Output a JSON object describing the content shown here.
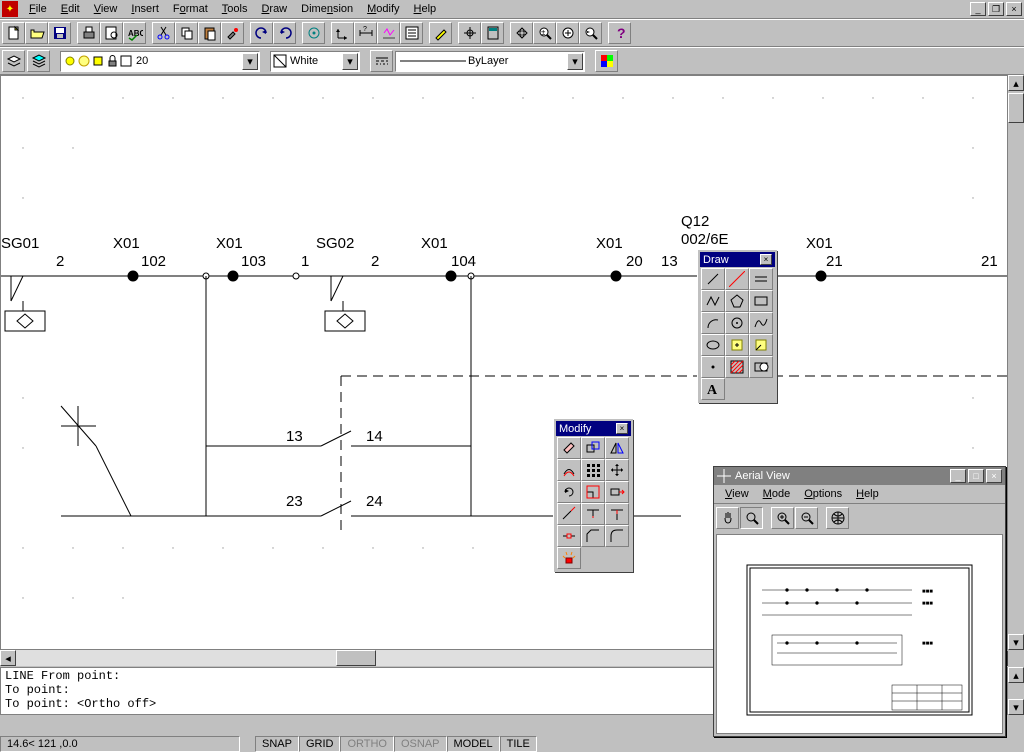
{
  "menu": {
    "file": "File",
    "edit": "Edit",
    "view": "View",
    "insert": "Insert",
    "format": "Format",
    "tools": "Tools",
    "draw": "Draw",
    "dimension": "Dimension",
    "modify": "Modify",
    "help": "Help"
  },
  "layer": {
    "current": "20",
    "color": "White",
    "linetype": "ByLayer"
  },
  "schematic": {
    "labels": {
      "sg01": "SG01",
      "sg02": "SG02",
      "q12": "Q12",
      "q12_val": "002/6E",
      "x01a": "X01",
      "x01b": "X01",
      "x01c": "X01",
      "x01d": "X01",
      "x01e": "X01",
      "n2a": "2",
      "n102": "102",
      "n103": "103",
      "n1": "1",
      "n2b": "2",
      "n104": "104",
      "n20": "20",
      "n13a": "13",
      "n21": "21",
      "n21b": "21",
      "n13": "13",
      "n14": "14",
      "n23": "23",
      "n24": "24"
    }
  },
  "palettes": {
    "draw_title": "Draw",
    "modify_title": "Modify"
  },
  "aerial": {
    "title": "Aerial View",
    "menu": {
      "view": "View",
      "mode": "Mode",
      "options": "Options",
      "help": "Help"
    }
  },
  "command": {
    "line1": "LINE From point:",
    "line2": "To point:",
    "line3": "To point:  <Ortho off>"
  },
  "status": {
    "coords": "14.6< 121 ,0.0",
    "snap": "SNAP",
    "grid": "GRID",
    "ortho": "ORTHO",
    "osnap": "OSNAP",
    "model": "MODEL",
    "tile": "TILE"
  }
}
